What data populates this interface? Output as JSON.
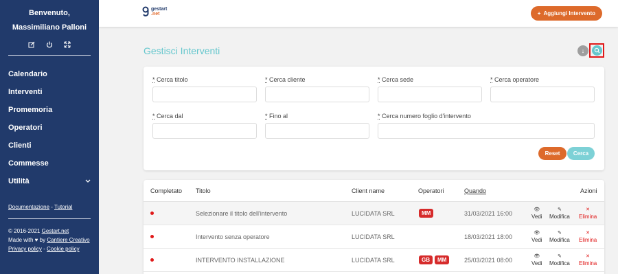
{
  "sidebar": {
    "welcome_line1": "Benvenuto,",
    "welcome_line2": "Massimiliano Palloni",
    "icons": [
      "edit-icon",
      "power-icon",
      "expand-icon"
    ],
    "items": [
      {
        "label": "Calendario"
      },
      {
        "label": "Interventi"
      },
      {
        "label": "Promemoria"
      },
      {
        "label": "Operatori"
      },
      {
        "label": "Clienti"
      },
      {
        "label": "Commesse"
      },
      {
        "label": "Utilità",
        "has_chevron": true
      }
    ],
    "doc_link": "Documentazione",
    "doc_sep": " - ",
    "tutorial_link": "Tutorial",
    "copyright_prefix": "© 2016-2021 ",
    "copyright_link": "Gestart.net",
    "made_with": "Made with ♥ by ",
    "made_by_link": "Cantiere Creativo",
    "privacy_link": "Privacy policy",
    "policy_sep": " - ",
    "cookie_link": "Cookie policy"
  },
  "header": {
    "logo_line1": "gestart",
    "logo_line2": ".net",
    "add_button": "Aggiungi Intervento",
    "add_icon": "+"
  },
  "page": {
    "title": "Gestisci Interventi",
    "download_icon": "↓",
    "search_icon": "⌕"
  },
  "filters": {
    "req_mark": "*",
    "fields": [
      {
        "label": "Cerca titolo",
        "value": ""
      },
      {
        "label": "Cerca cliente",
        "value": ""
      },
      {
        "label": "Cerca sede",
        "value": ""
      },
      {
        "label": "Cerca operatore",
        "value": ""
      },
      {
        "label": "Cerca dal",
        "value": ""
      },
      {
        "label": "Fino al",
        "value": ""
      },
      {
        "label": "Cerca numero foglio d'intervento",
        "value": ""
      }
    ],
    "reset_button": "Reset",
    "search_button": "Cerca"
  },
  "table": {
    "headers": {
      "completato": "Completato",
      "titolo": "Titolo",
      "client": "Client name",
      "operatori": "Operatori",
      "quando": "Quando",
      "azioni": "Azioni"
    },
    "actions": {
      "view": "Vedi",
      "edit": "Modifica",
      "delete": "Elimina",
      "view_icon": "👁",
      "edit_icon": "✎",
      "delete_icon": "✕"
    },
    "rows": [
      {
        "completed": false,
        "title": "Selezionare il titolo dell'intervento",
        "client": "LUCIDATA SRL",
        "operators": [
          "MM"
        ],
        "when": "31/03/2021 16:00"
      },
      {
        "completed": false,
        "title": "Intervento senza operatore",
        "client": "LUCIDATA SRL",
        "operators": [],
        "when": "18/03/2021 18:00"
      },
      {
        "completed": false,
        "title": "INTERVENTO INSTALLAZIONE",
        "client": "LUCIDATA SRL",
        "operators": [
          "GB",
          "MM"
        ],
        "when": "25/03/2021 08:00"
      }
    ]
  },
  "colors": {
    "sidebar_bg": "#213a6b",
    "accent_orange": "#dd6a2b",
    "accent_teal": "#66c7cd",
    "badge_red": "#d62b2b",
    "highlight_red": "#e01919"
  }
}
